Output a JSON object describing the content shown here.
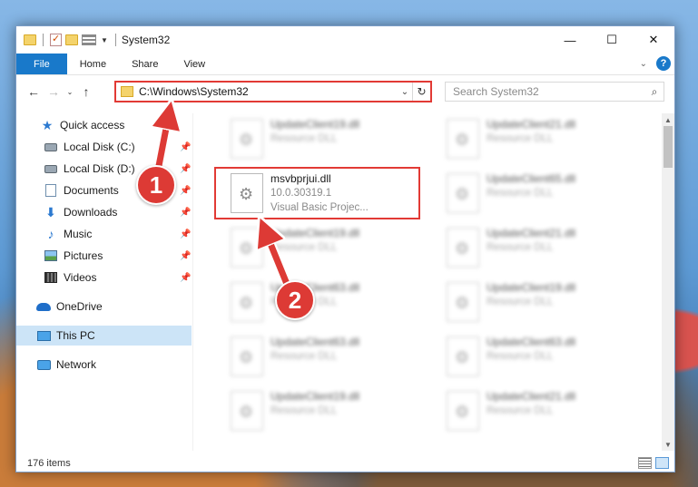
{
  "window": {
    "title": "System32",
    "controls": {
      "minimize": "—",
      "maximize": "☐",
      "close": "✕"
    }
  },
  "ribbon": {
    "tabs": [
      "File",
      "Home",
      "Share",
      "View"
    ],
    "help_label": "?"
  },
  "nav": {
    "back": "←",
    "forward": "→",
    "recent_dd": "⌄",
    "up": "↑",
    "address": "C:\\Windows\\System32",
    "address_dd": "⌄",
    "refresh": "↻",
    "search_placeholder": "Search System32",
    "search_glyph": "⌕"
  },
  "sidebar": {
    "items": [
      {
        "label": "Quick access",
        "icon": "quick-access-star-icon"
      },
      {
        "label": "Local Disk (C:)",
        "icon": "drive-icon",
        "pinned": true
      },
      {
        "label": "Local Disk (D:)",
        "icon": "drive-icon",
        "pinned": true
      },
      {
        "label": "Documents",
        "icon": "documents-icon",
        "pinned": true
      },
      {
        "label": "Downloads",
        "icon": "downloads-icon",
        "pinned": true
      },
      {
        "label": "Music",
        "icon": "music-icon",
        "pinned": true
      },
      {
        "label": "Pictures",
        "icon": "pictures-icon",
        "pinned": true
      },
      {
        "label": "Videos",
        "icon": "videos-icon",
        "pinned": true
      },
      {
        "label": "OneDrive",
        "icon": "onedrive-icon"
      },
      {
        "label": "This PC",
        "icon": "this-pc-icon",
        "selected": true
      },
      {
        "label": "Network",
        "icon": "network-icon"
      }
    ]
  },
  "files": [
    {
      "name": "UpdateClient19.dll",
      "type": "Resource DLL",
      "blurred": true
    },
    {
      "name": "UpdateClient21.dll",
      "type": "Resource DLL",
      "blurred": true
    },
    {
      "name": "msvbprjui.dll",
      "version": "10.0.30319.1",
      "description": "Visual Basic Projec...",
      "blurred": false,
      "highlighted": true
    },
    {
      "name": "UpdateClient65.dll",
      "type": "Resource DLL",
      "blurred": true
    },
    {
      "name": "UpdateClient19.dll",
      "type": "Resource DLL",
      "blurred": true
    },
    {
      "name": "UpdateClient21.dll",
      "type": "Resource DLL",
      "blurred": true
    },
    {
      "name": "UpdateClient63.dll",
      "type": "Resource DLL",
      "blurred": true
    },
    {
      "name": "UpdateClient19.dll",
      "type": "Resource DLL",
      "blurred": true
    },
    {
      "name": "UpdateClient63.dll",
      "type": "Resource DLL",
      "blurred": true
    },
    {
      "name": "UpdateClient63.dll",
      "type": "Resource DLL",
      "blurred": true
    },
    {
      "name": "UpdateClient19.dll",
      "type": "Resource DLL",
      "blurred": true
    },
    {
      "name": "UpdateClient21.dll",
      "type": "Resource DLL",
      "blurred": true
    }
  ],
  "status": {
    "item_count": "176 items"
  },
  "annotations": {
    "step1": "1",
    "step2": "2"
  },
  "colors": {
    "accent": "#1979ca",
    "highlight_red": "#e23a35",
    "selection": "#cce4f7"
  }
}
